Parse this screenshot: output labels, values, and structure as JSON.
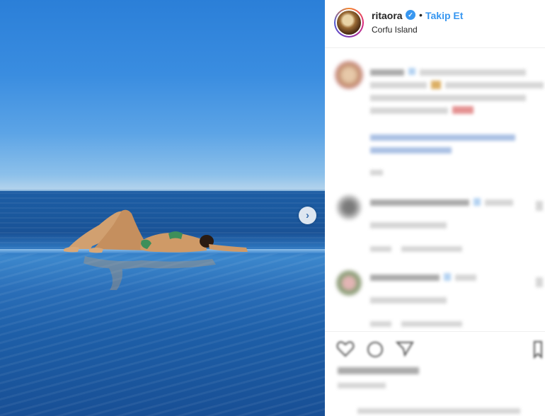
{
  "post": {
    "username": "ritaora",
    "verified_icon": "verified-badge-icon",
    "separator": "•",
    "follow_label": "Takip Et",
    "location": "Corfu Island"
  },
  "carousel": {
    "next_icon": "chevron-right-icon",
    "next_glyph": "›"
  },
  "icons": {
    "like": "heart-icon",
    "comment": "comment-icon",
    "share": "share-icon",
    "save": "bookmark-icon"
  },
  "colors": {
    "accent": "#3897f0",
    "username": "#262626",
    "divider": "#efefef"
  }
}
